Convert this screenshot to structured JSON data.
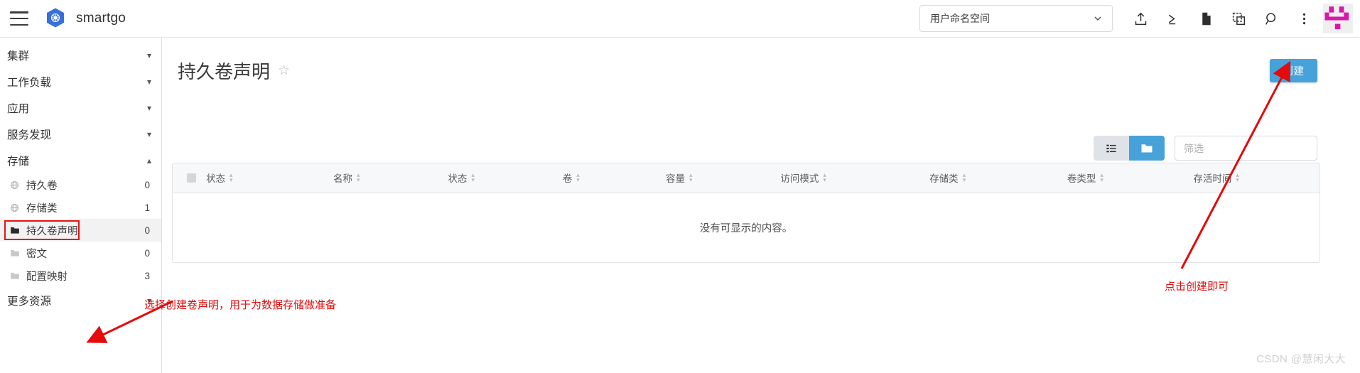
{
  "topbar": {
    "menu_icon": "hamburger-menu-icon",
    "logo_icon": "kubernetes-logo-icon",
    "brand": "smartgo",
    "namespace_selector": {
      "value": "用户命名空间",
      "chevron_icon": "chevron-down-icon"
    },
    "actions": [
      {
        "name": "upload-icon",
        "title": "上传"
      },
      {
        "name": "terminal-icon",
        "title": "终端"
      },
      {
        "name": "document-icon",
        "title": "文档"
      },
      {
        "name": "copy-overlay-icon",
        "title": "复制"
      },
      {
        "name": "search-icon",
        "title": "搜索"
      },
      {
        "name": "more-vertical-icon",
        "title": "更多"
      }
    ],
    "avatar_icon": "user-avatar-icon"
  },
  "sidebar": {
    "groups": [
      {
        "label": "集群",
        "expanded": false,
        "chevron": "chevron-down-icon"
      },
      {
        "label": "工作负载",
        "expanded": false,
        "chevron": "chevron-down-icon"
      },
      {
        "label": "应用",
        "expanded": false,
        "chevron": "chevron-down-icon"
      },
      {
        "label": "服务发现",
        "expanded": false,
        "chevron": "chevron-down-icon"
      },
      {
        "label": "存储",
        "expanded": true,
        "chevron": "chevron-up-icon"
      }
    ],
    "storage_items": [
      {
        "label": "持久卷",
        "count": "0",
        "icon": "globe-icon",
        "active": false
      },
      {
        "label": "存储类",
        "count": "1",
        "icon": "globe-icon",
        "active": false
      },
      {
        "label": "持久卷声明",
        "count": "0",
        "icon": "folder-filled-icon",
        "active": true
      },
      {
        "label": "密文",
        "count": "0",
        "icon": "folder-icon",
        "active": false
      },
      {
        "label": "配置映射",
        "count": "3",
        "icon": "folder-icon",
        "active": false
      }
    ],
    "more_group": {
      "label": "更多资源",
      "chevron": "chevron-down-icon"
    }
  },
  "main": {
    "page_title": "持久卷声明",
    "star_icon": "star-outline-icon",
    "create_button": "创建",
    "view_toggle": [
      {
        "name": "list-view-icon",
        "active": false
      },
      {
        "name": "folder-view-icon",
        "active": true
      }
    ],
    "filter_placeholder": "筛选",
    "filter_value": "",
    "table": {
      "columns": [
        {
          "label": "状态",
          "sort": true
        },
        {
          "label": "名称",
          "sort": true
        },
        {
          "label": "状态",
          "sort": true
        },
        {
          "label": "卷",
          "sort": true
        },
        {
          "label": "容量",
          "sort": true
        },
        {
          "label": "访问模式",
          "sort": true
        },
        {
          "label": "存储类",
          "sort": true
        },
        {
          "label": "卷类型",
          "sort": true
        },
        {
          "label": "存活时间",
          "sort": true
        }
      ],
      "rows": [],
      "empty_message": "没有可显示的内容。"
    }
  },
  "annotations": {
    "left_text": "选择创建卷声明，用于为数据存储做准备",
    "right_text": "点击创建即可",
    "color": "#e30b0b"
  },
  "watermark": "CSDN @慧闲大大",
  "colors": {
    "accent_blue": "#46a2d8",
    "annotation_red": "#e30b0b",
    "avatar_magenta": "#da17aa",
    "header_bg": "#f7f8fa"
  }
}
